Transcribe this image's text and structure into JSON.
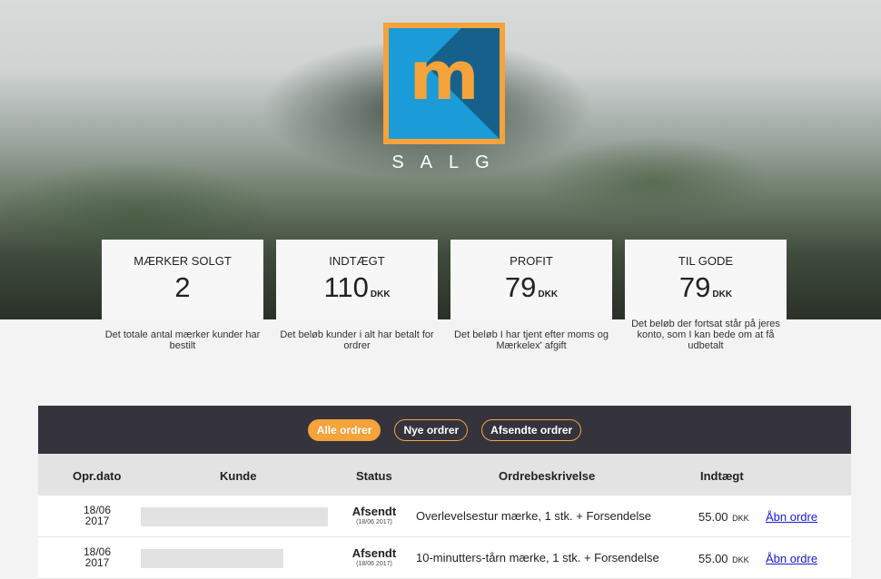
{
  "brand": {
    "logo_letter": "m",
    "name": "SALG",
    "colors": {
      "logo_border": "#f5a33a",
      "logo_bg": "#1b9bd8",
      "accent": "#f5a33a"
    }
  },
  "stats": [
    {
      "title": "MÆRKER SOLGT",
      "value": "2",
      "unit": "",
      "description": "Det totale antal mærker kunder har bestilt"
    },
    {
      "title": "INDTÆGT",
      "value": "110",
      "unit": "DKK",
      "description": "Det beløb kunder i alt har betalt for ordrer"
    },
    {
      "title": "PROFIT",
      "value": "79",
      "unit": "DKK",
      "description": "Det beløb I har tjent efter moms og Mærkelex' afgift"
    },
    {
      "title": "TIL GODE",
      "value": "79",
      "unit": "DKK",
      "description": "Det beløb der fortsat står på jeres konto, som I kan bede om at få udbetalt"
    }
  ],
  "filters": [
    {
      "label": "Alle ordrer",
      "active": true
    },
    {
      "label": "Nye ordrer",
      "active": false
    },
    {
      "label": "Afsendte ordrer",
      "active": false
    }
  ],
  "table": {
    "columns": [
      "Opr.dato",
      "Kunde",
      "Status",
      "Ordrebeskrivelse",
      "Indtægt"
    ],
    "rows": [
      {
        "date_line1": "18/06",
        "date_line2": "2017",
        "status": "Afsendt",
        "status_date": "(18/06 2017)",
        "description": "Overlevelsestur mærke, 1 stk. + Forsendelse",
        "amount": "55.00",
        "unit": "DKK",
        "action": "Åbn ordre"
      },
      {
        "date_line1": "18/06",
        "date_line2": "2017",
        "status": "Afsendt",
        "status_date": "(18/06 2017)",
        "description": "10-minutters-tårn mærke, 1 stk. + Forsendelse",
        "amount": "55.00",
        "unit": "DKK",
        "action": "Åbn ordre"
      }
    ]
  }
}
